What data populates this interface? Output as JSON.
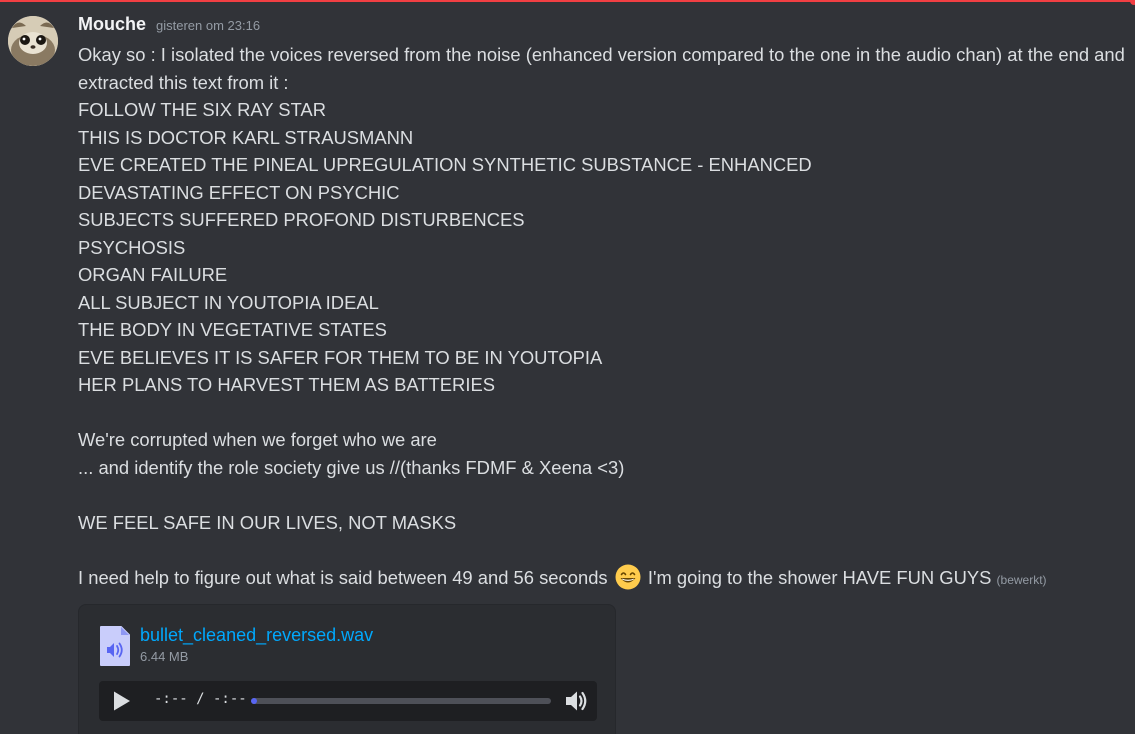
{
  "message": {
    "author": "Mouche",
    "timestamp": "gisteren om 23:16",
    "lines": [
      "Okay so : I isolated the voices reversed from the noise (enhanced version compared to the one in the audio chan) at the end and extracted this text from it :",
      "FOLLOW THE SIX RAY STAR",
      "THIS IS DOCTOR KARL STRAUSMANN",
      "EVE CREATED THE PINEAL UPREGULATION SYNTHETIC SUBSTANCE - ENHANCED",
      "DEVASTATING EFFECT ON PSYCHIC",
      "SUBJECTS SUFFERED PROFOND DISTURBENCES",
      "PSYCHOSIS",
      "ORGAN FAILURE",
      "ALL SUBJECT IN YOUTOPIA IDEAL",
      "THE BODY IN VEGETATIVE STATES",
      "EVE BELIEVES IT IS SAFER FOR THEM TO BE IN YOUTOPIA",
      "HER PLANS TO HARVEST THEM AS BATTERIES",
      "",
      "We're corrupted when we forget who we are",
      "... and identify the role society give us //(thanks FDMF & Xeena <3)",
      "",
      "WE FEEL SAFE IN OUR LIVES, NOT MASKS",
      ""
    ],
    "last_line_before_emoji": "I need help to figure out what is said between 49 and 56 seconds",
    "emoji": "grinning-face-with-smiling-eyes",
    "last_line_after_emoji": "I'm going to the shower HAVE FUN GUYS",
    "edited_label": "(bewerkt)"
  },
  "attachment": {
    "file_name": "bullet_cleaned_reversed.wav",
    "file_size": "6.44 MB",
    "time_display": "-:-- / -:--",
    "progress": 0.02,
    "file_icon": "audio-file-icon",
    "play_icon": "play-icon",
    "volume_icon": "volume-icon"
  },
  "colors": {
    "background": "#313338",
    "link": "#00a8fc",
    "accent": "#5865f2",
    "top_line": "#f23f43"
  }
}
